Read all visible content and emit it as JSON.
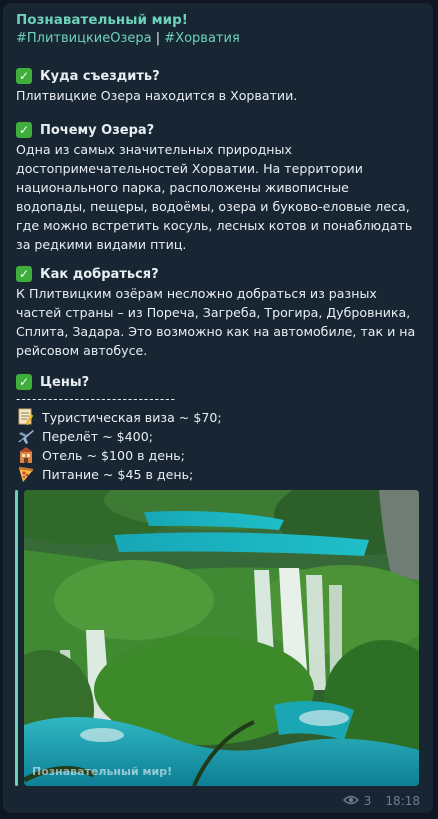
{
  "post": {
    "channel_name": "Познавательный мир!",
    "tag1": "#ПлитвицкиеОзера",
    "tag_separator": "|",
    "tag2": "#Хорватия"
  },
  "sections": [
    {
      "title": "Куда съездить?",
      "text": "Плитвицкие Озера находится в Хорватии."
    },
    {
      "title": "Почему Озера?",
      "text": "Одна из самых значительных природных достопримечательностей Хорватии. На территории национального парка, расположены живописные водопады, пещеры, водоёмы, озера и буково-еловые леса, где можно встретить косуль, лесных котов и понаблюдать за редкими видами птиц."
    },
    {
      "title": "Как добраться?",
      "text": "К Плитвицким озёрам несложно добраться из разных частей страны – из Пореча, Загреба, Трогира, Дубровника, Сплита, Задара. Это возможно как на автомобиле, так и на рейсовом автобусе."
    },
    {
      "title": "Цены?",
      "text": ""
    }
  ],
  "prices": {
    "divider": "------------------------------",
    "items": [
      {
        "icon": "memo-icon",
        "text": "Туристическая виза ~ $70;"
      },
      {
        "icon": "airplane-icon",
        "text": "Перелёт ~ $400;"
      },
      {
        "icon": "hotel-icon",
        "text": "Отель ~ $100 в день;"
      },
      {
        "icon": "pizza-icon",
        "text": "Питание ~ $45 в день;"
      }
    ]
  },
  "photo": {
    "watermark": "Познавательный мир!"
  },
  "meta": {
    "views": "3",
    "time": "18:18"
  },
  "colors": {
    "background": "#0e1621",
    "bubble": "#182533",
    "accent": "#6ed2ba",
    "check": "#3fae3a",
    "meta": "#6d7f8f"
  }
}
